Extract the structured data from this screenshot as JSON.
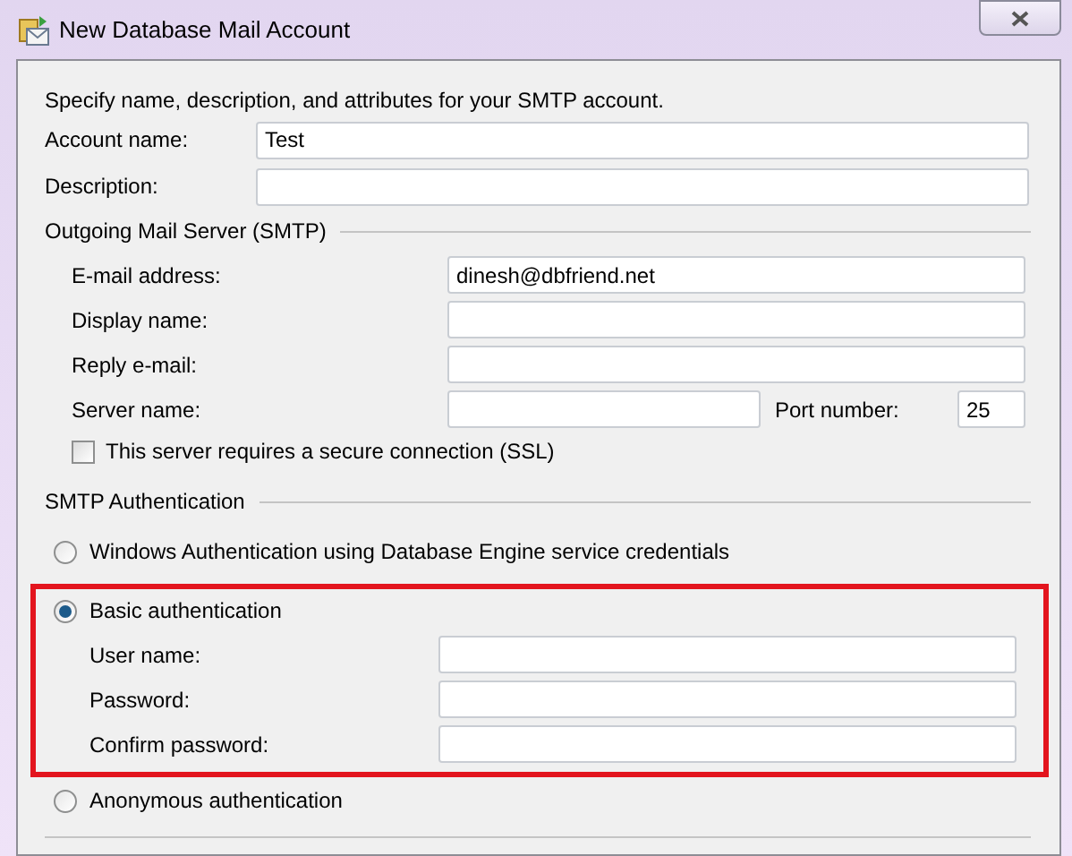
{
  "window": {
    "title": "New Database Mail Account"
  },
  "intro": "Specify name, description, and attributes for your SMTP account.",
  "account_fields": [
    {
      "label": "Account name:",
      "value": "Test"
    },
    {
      "label": "Description:"
    }
  ],
  "outgoing_server": {
    "heading": "Outgoing Mail Server (SMTP)",
    "fields": [
      {
        "label": "E-mail address:",
        "value": "dinesh@dbfriend.net"
      },
      {
        "label": "Display name:"
      },
      {
        "label": "Reply e-mail:"
      }
    ],
    "server_name": {
      "label": "Server name:"
    },
    "port": {
      "label": "Port number:",
      "value": "25"
    },
    "ssl": {
      "label": "This server requires a secure connection (SSL)",
      "checked": false
    }
  },
  "smtp_authentication": {
    "heading": "SMTP Authentication",
    "options": [
      {
        "label": "Windows Authentication using Database Engine service credentials",
        "selected": false,
        "highlighted": false
      },
      {
        "label": "Basic authentication",
        "selected": true,
        "highlighted": true,
        "fields": [
          {
            "label": "User name:"
          },
          {
            "label": "Password:"
          },
          {
            "label": "Confirm password:"
          }
        ]
      },
      {
        "label": "Anonymous authentication",
        "selected": false,
        "highlighted": false
      }
    ]
  }
}
